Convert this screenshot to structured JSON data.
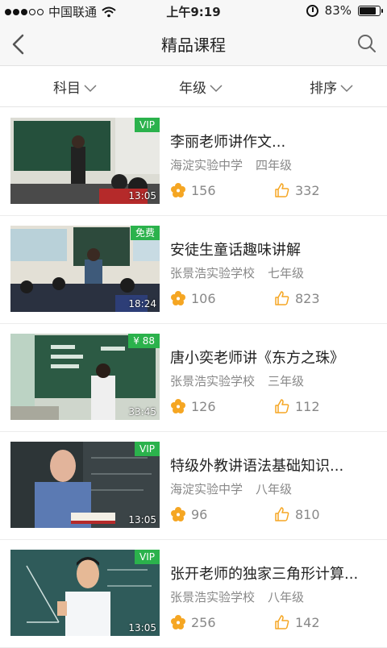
{
  "status_bar": {
    "carrier": "中国联通",
    "time": "上午9:19",
    "battery": "83%",
    "battery_level": 0.83
  },
  "header": {
    "title": "精品课程"
  },
  "filters": [
    {
      "label": "科目"
    },
    {
      "label": "年级"
    },
    {
      "label": "排序"
    }
  ],
  "courses": [
    {
      "title": "李丽老师讲作文...",
      "school": "海淀实验中学",
      "grade": "四年级",
      "tag": "VIP",
      "duration": "13:05",
      "favorites": "156",
      "likes": "332"
    },
    {
      "title": "安徒生童话趣味讲解",
      "school": "张景浩实验学校",
      "grade": "七年级",
      "tag": "免费",
      "duration": "18:24",
      "favorites": "106",
      "likes": "823"
    },
    {
      "title": "唐小奕老师讲《东方之珠》",
      "school": "张景浩实验学校",
      "grade": "三年级",
      "tag": "¥ 88",
      "duration": "33:45",
      "favorites": "126",
      "likes": "112"
    },
    {
      "title": "特级外教讲语法基础知识...",
      "school": "海淀实验中学",
      "grade": "八年级",
      "tag": "VIP",
      "duration": "13:05",
      "favorites": "96",
      "likes": "810"
    },
    {
      "title": "张开老师的独家三角形计算...",
      "school": "张景浩实验学校",
      "grade": "八年级",
      "tag": "VIP",
      "duration": "13:05",
      "favorites": "256",
      "likes": "142"
    }
  ],
  "colors": {
    "accent_orange": "#f5a623",
    "tag_green": "#2bb24c",
    "text_gray": "#888888"
  }
}
